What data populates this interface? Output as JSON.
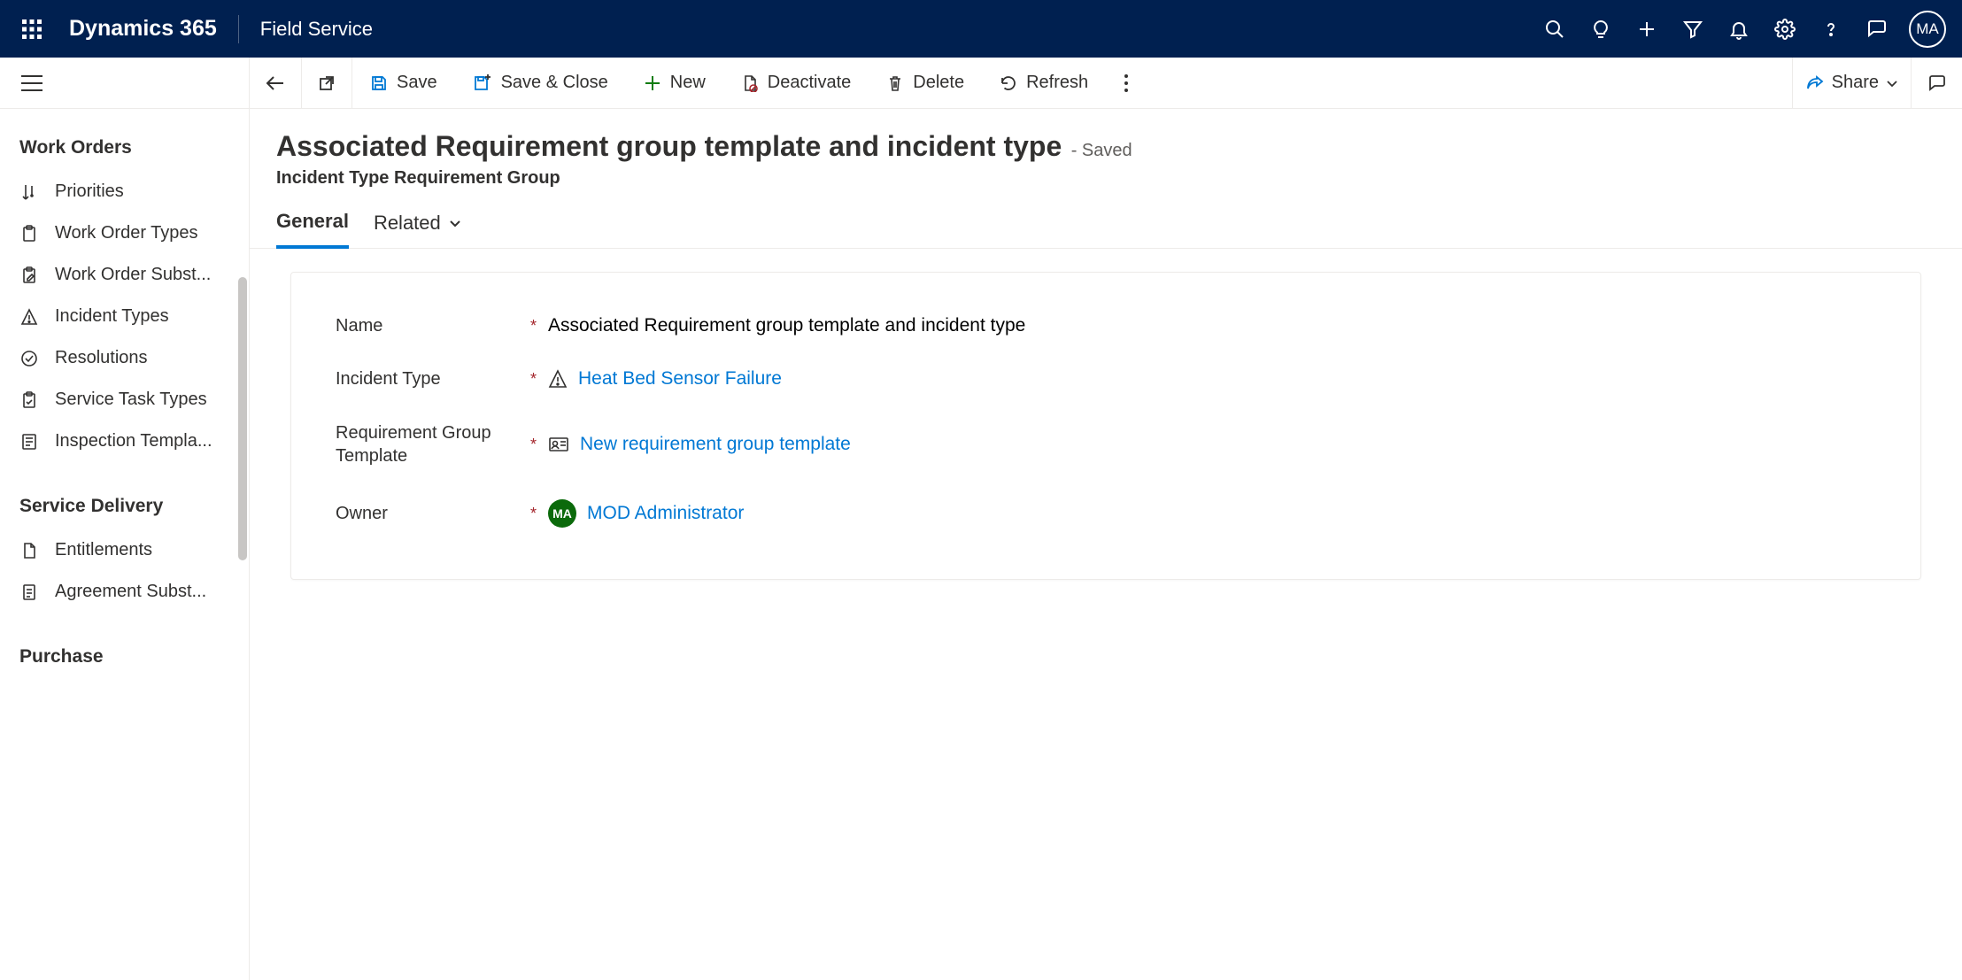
{
  "topbar": {
    "brand": "Dynamics 365",
    "module": "Field Service",
    "avatar_initials": "MA"
  },
  "sidebar": {
    "groups": [
      {
        "title": "Work Orders",
        "items": [
          {
            "label": "Priorities",
            "icon": "priority"
          },
          {
            "label": "Work Order Types",
            "icon": "clipboard"
          },
          {
            "label": "Work Order Subst...",
            "icon": "clipboard-edit"
          },
          {
            "label": "Incident Types",
            "icon": "warning"
          },
          {
            "label": "Resolutions",
            "icon": "check-circle"
          },
          {
            "label": "Service Task Types",
            "icon": "clipboard-task"
          },
          {
            "label": "Inspection Templa...",
            "icon": "list"
          }
        ]
      },
      {
        "title": "Service Delivery",
        "items": [
          {
            "label": "Entitlements",
            "icon": "document"
          },
          {
            "label": "Agreement Subst...",
            "icon": "document-lines"
          }
        ]
      },
      {
        "title": "Purchase",
        "items": []
      }
    ]
  },
  "commandbar": {
    "save": "Save",
    "save_close": "Save & Close",
    "new": "New",
    "deactivate": "Deactivate",
    "delete": "Delete",
    "refresh": "Refresh",
    "share": "Share"
  },
  "page": {
    "title": "Associated Requirement group template and incident type",
    "status": "- Saved",
    "subtitle": "Incident Type Requirement Group"
  },
  "tabs": {
    "general": "General",
    "related": "Related"
  },
  "form": {
    "name": {
      "label": "Name",
      "required": true,
      "value": "Associated Requirement group template and incident type"
    },
    "incident_type": {
      "label": "Incident Type",
      "required": true,
      "value": "Heat Bed Sensor Failure"
    },
    "req_group_template": {
      "label": "Requirement Group Template",
      "required": true,
      "value": "New requirement group template"
    },
    "owner": {
      "label": "Owner",
      "required": true,
      "value": "MOD Administrator",
      "badge": "MA"
    }
  }
}
